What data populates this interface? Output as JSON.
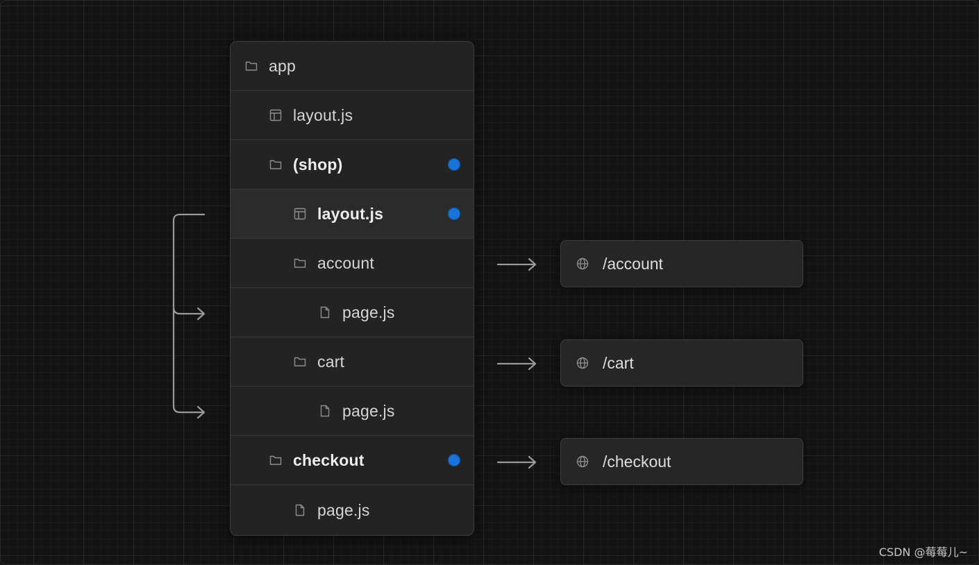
{
  "tree": {
    "items": [
      {
        "label": "app",
        "icon": "folder-icon",
        "bold": false,
        "marker": false
      },
      {
        "label": "layout.js",
        "icon": "layout-icon",
        "bold": false,
        "marker": false
      },
      {
        "label": "(shop)",
        "icon": "folder-icon",
        "bold": true,
        "marker": true
      },
      {
        "label": "layout.js",
        "icon": "layout-icon",
        "bold": true,
        "marker": true
      },
      {
        "label": "account",
        "icon": "folder-icon",
        "bold": false,
        "marker": false
      },
      {
        "label": "page.js",
        "icon": "file-icon",
        "bold": false,
        "marker": false
      },
      {
        "label": "cart",
        "icon": "folder-icon",
        "bold": false,
        "marker": false
      },
      {
        "label": "page.js",
        "icon": "file-icon",
        "bold": false,
        "marker": false
      },
      {
        "label": "checkout",
        "icon": "folder-icon",
        "bold": true,
        "marker": true
      },
      {
        "label": "page.js",
        "icon": "file-icon",
        "bold": false,
        "marker": false
      }
    ]
  },
  "routes": [
    {
      "url": "/account",
      "icon": "globe-icon"
    },
    {
      "url": "/cart",
      "icon": "globe-icon"
    },
    {
      "url": "/checkout",
      "icon": "globe-icon"
    }
  ],
  "colors": {
    "background": "#131313",
    "panel": "#232323",
    "marker": "#1a73d9",
    "connector": "#9a9a9a"
  },
  "watermark": "CSDN @莓莓儿~"
}
